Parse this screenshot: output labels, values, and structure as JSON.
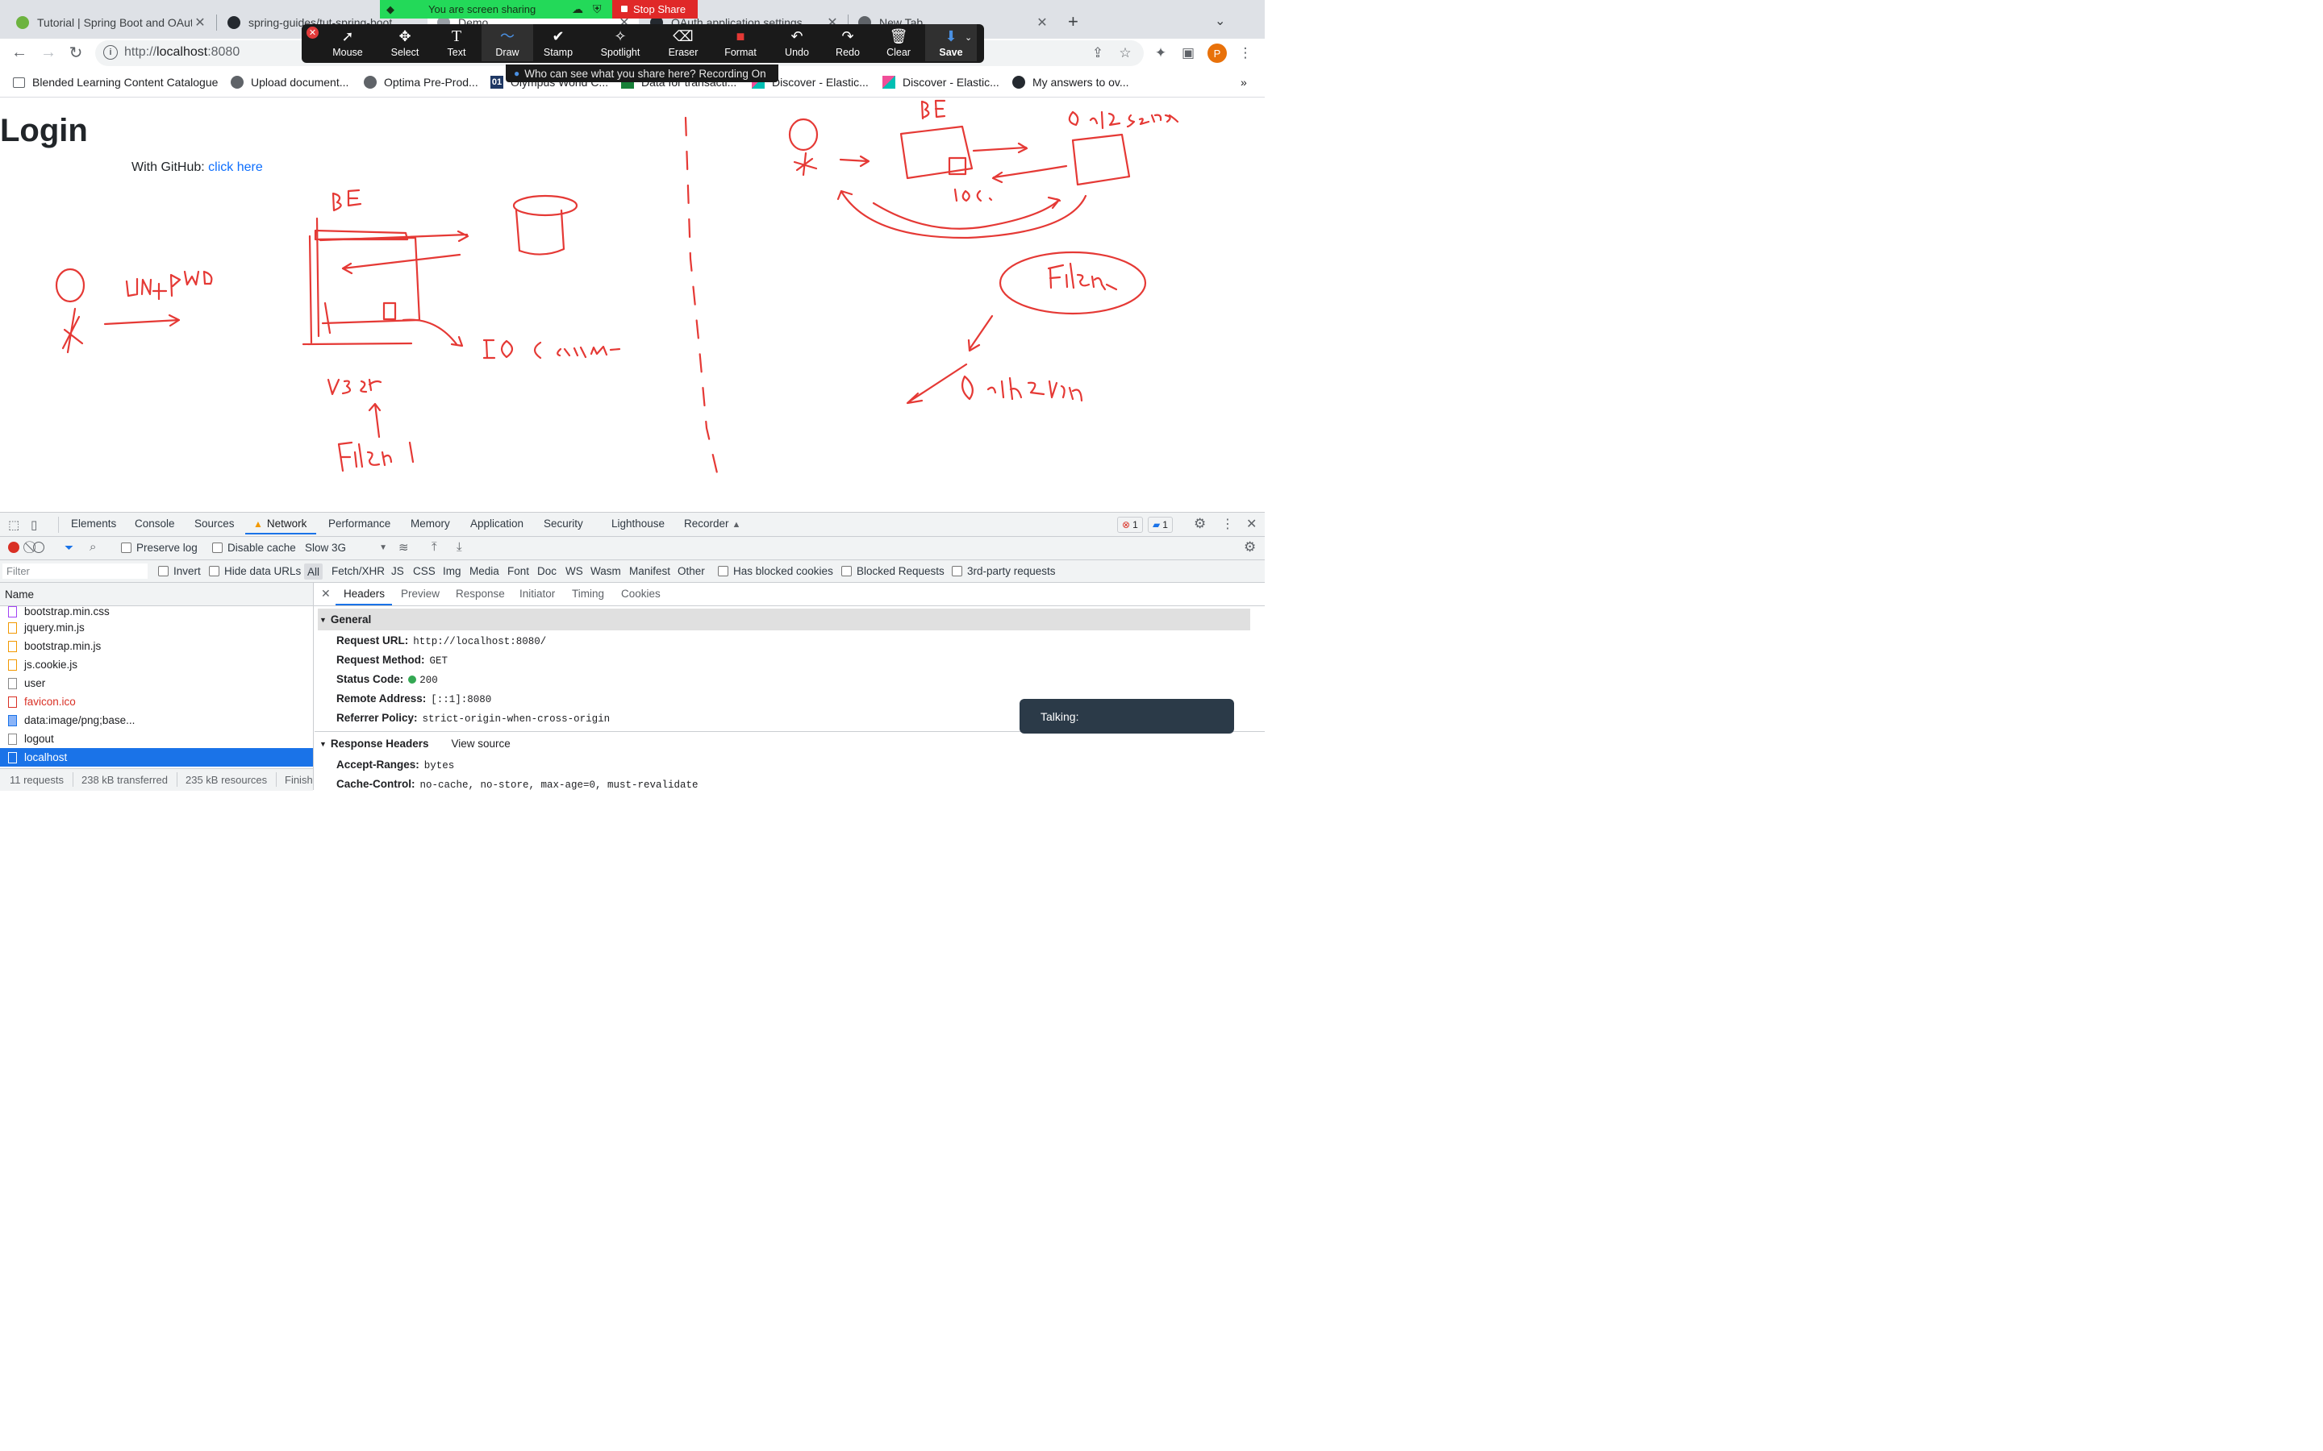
{
  "zoom": {
    "share_banner": "You are screen sharing",
    "stop_share": "Stop Share",
    "recording_tip": "Who can see what you share here? Recording On",
    "tools": [
      {
        "label": "Mouse",
        "icon": "mouse-pointer-icon",
        "glyph": "➚"
      },
      {
        "label": "Select",
        "icon": "move-icon",
        "glyph": "✥"
      },
      {
        "label": "Text",
        "icon": "text-icon",
        "glyph": "T"
      },
      {
        "label": "Draw",
        "icon": "draw-icon",
        "glyph": "〜"
      },
      {
        "label": "Stamp",
        "icon": "checkmark-icon",
        "glyph": "✔"
      },
      {
        "label": "Spotlight",
        "icon": "spotlight-wand-icon",
        "glyph": "✧"
      },
      {
        "label": "Eraser",
        "icon": "eraser-icon",
        "glyph": "⌫"
      },
      {
        "label": "Format",
        "icon": "format-color-icon",
        "glyph": "■"
      },
      {
        "label": "Undo",
        "icon": "undo-icon",
        "glyph": "↶"
      },
      {
        "label": "Redo",
        "icon": "redo-icon",
        "glyph": "↷"
      },
      {
        "label": "Clear",
        "icon": "trash-icon",
        "glyph": "🗑"
      },
      {
        "label": "Save",
        "icon": "save-download-icon",
        "glyph": "⬇"
      }
    ],
    "active_tool": "Draw",
    "format_color": "#e53935"
  },
  "browser": {
    "tabs": [
      {
        "title": "Tutorial | Spring Boot and OAut",
        "icon": "spring-leaf-icon",
        "color": "#6db33f"
      },
      {
        "title": "spring-guides/tut-spring-boot",
        "icon": "github-icon",
        "color": "#24292f"
      },
      {
        "title": "Demo",
        "icon": "globe-icon",
        "color": "#5f6368"
      },
      {
        "title": "OAuth application settings",
        "icon": "github-icon",
        "color": "#24292f"
      },
      {
        "title": "New Tab",
        "icon": "chrome-icon",
        "color": "#5f6368"
      }
    ],
    "url_scheme": "http://",
    "url_host": "localhost",
    "url_rest": ":8080",
    "profile_initial": "P",
    "bookmarks": [
      {
        "label": "Blended Learning Content Catalogue",
        "icon": "folder-icon"
      },
      {
        "label": "Upload document...",
        "icon": "globe-icon"
      },
      {
        "label": "Optima Pre-Prod...",
        "icon": "globe-icon"
      },
      {
        "label": "Olympus World C...",
        "icon": "olympus-icon"
      },
      {
        "label": "Data for transacti...",
        "icon": "sheet-icon"
      },
      {
        "label": "Discover - Elastic...",
        "icon": "kibana-icon"
      },
      {
        "label": "Discover - Elastic...",
        "icon": "kibana-icon"
      },
      {
        "label": "My answers to ov...",
        "icon": "github-icon"
      }
    ],
    "more_bookmarks": "»"
  },
  "page": {
    "title": "Login",
    "github_prefix": "With GitHub: ",
    "github_link": "click here"
  },
  "devtools": {
    "tabs": [
      "Elements",
      "Console",
      "Sources",
      "Network",
      "Performance",
      "Memory",
      "Application",
      "Security",
      "Lighthouse",
      "Recorder"
    ],
    "active_tab": "Network",
    "errors_count": "1",
    "messages_count": "1",
    "preserve_log": "Preserve log",
    "disable_cache": "Disable cache",
    "throttling": "Slow 3G",
    "filter_placeholder": "Filter",
    "invert": "Invert",
    "hide_data_urls": "Hide data URLs",
    "type_filters": [
      "All",
      "Fetch/XHR",
      "JS",
      "CSS",
      "Img",
      "Media",
      "Font",
      "Doc",
      "WS",
      "Wasm",
      "Manifest",
      "Other"
    ],
    "has_blocked_cookies": "Has blocked cookies",
    "blocked_requests": "Blocked Requests",
    "third_party": "3rd-party requests",
    "name_header": "Name",
    "requests": [
      {
        "name": "bootstrap.min.css",
        "type": "css"
      },
      {
        "name": "jquery.min.js",
        "type": "js"
      },
      {
        "name": "bootstrap.min.js",
        "type": "js"
      },
      {
        "name": "js.cookie.js",
        "type": "js"
      },
      {
        "name": "user",
        "type": "doc"
      },
      {
        "name": "favicon.ico",
        "type": "error"
      },
      {
        "name": "data:image/png;base...",
        "type": "img"
      },
      {
        "name": "logout",
        "type": "doc"
      },
      {
        "name": "localhost",
        "type": "selected"
      }
    ],
    "summary": [
      "11 requests",
      "238 kB transferred",
      "235 kB resources",
      "Finish"
    ],
    "detail_tabs": [
      "Headers",
      "Preview",
      "Response",
      "Initiator",
      "Timing",
      "Cookies"
    ],
    "general_title": "General",
    "general": [
      {
        "key": "Request URL:",
        "value": "http://localhost:8080/"
      },
      {
        "key": "Request Method:",
        "value": "GET"
      },
      {
        "key": "Status Code:",
        "value": "200"
      },
      {
        "key": "Remote Address:",
        "value": "[::1]:8080"
      },
      {
        "key": "Referrer Policy:",
        "value": "strict-origin-when-cross-origin"
      }
    ],
    "response_headers_title": "Response Headers",
    "view_source": "View source",
    "response_headers": [
      {
        "key": "Accept-Ranges:",
        "value": "bytes"
      },
      {
        "key": "Cache-Control:",
        "value": "no-cache, no-store, max-age=0, must-revalidate"
      }
    ]
  },
  "talking": "Talking:"
}
